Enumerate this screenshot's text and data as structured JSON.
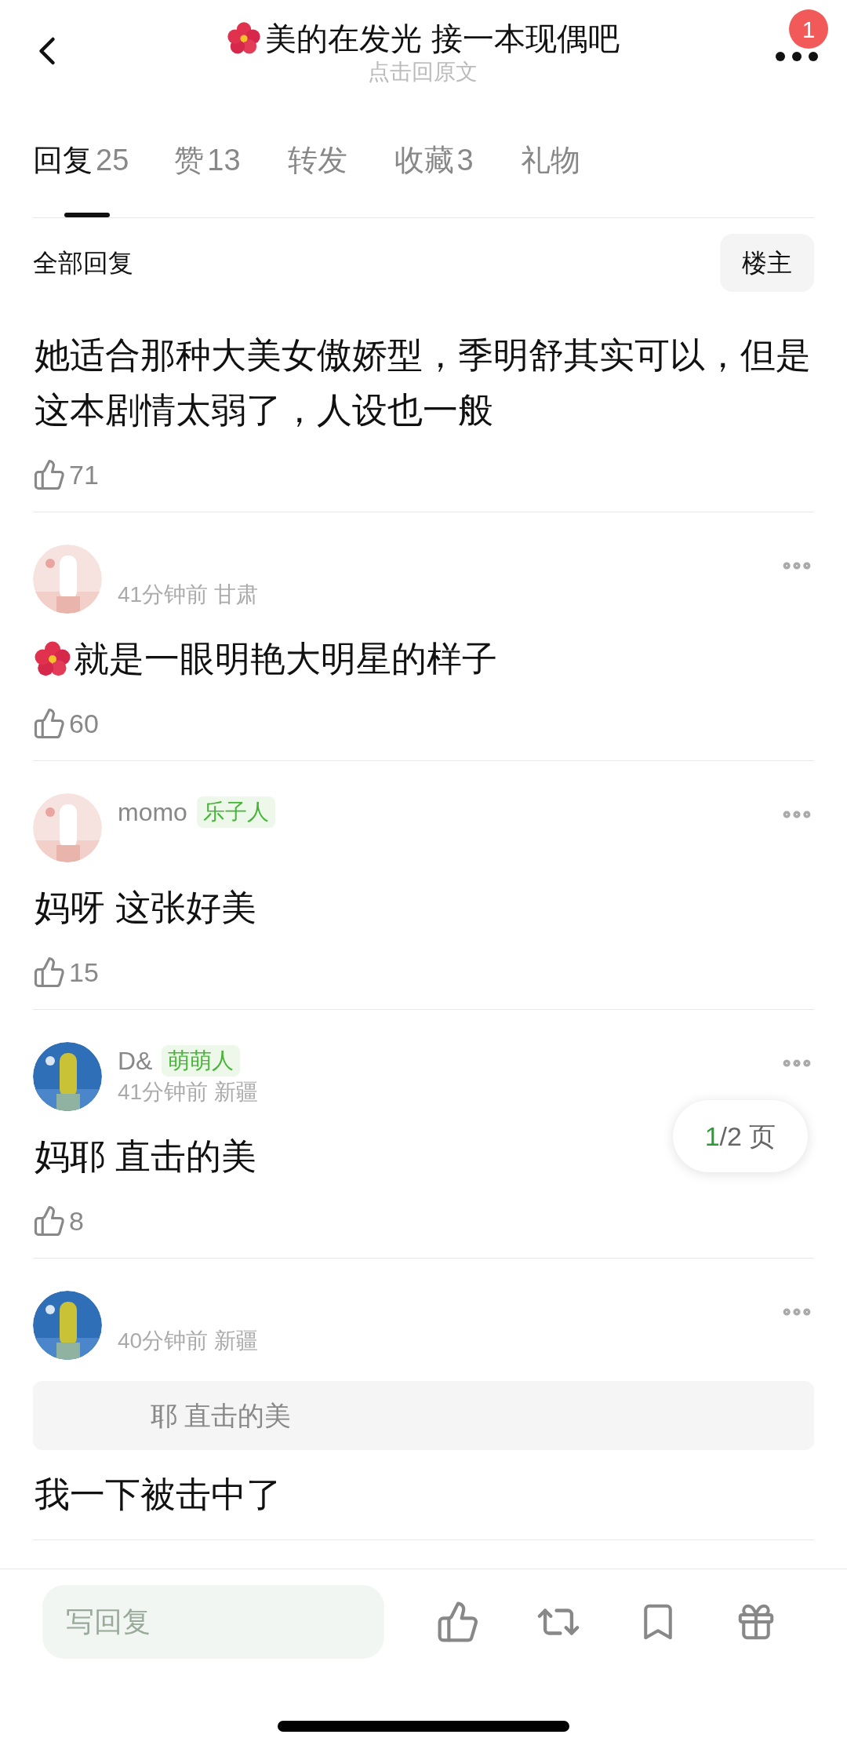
{
  "header": {
    "title": "美的在发光 接一本现偶吧",
    "subtitle": "点击回原文",
    "notification_count": "1"
  },
  "tabs": [
    {
      "label": "回复",
      "count": "25",
      "selected": true
    },
    {
      "label": "赞",
      "count": "13",
      "selected": false
    },
    {
      "label": "转发",
      "selected": false
    },
    {
      "label": "收藏",
      "count": "3",
      "selected": false
    },
    {
      "label": "礼物",
      "selected": false
    }
  ],
  "section_title": "全部回复",
  "filter_button": "楼主",
  "comments": [
    {
      "text": "她适合那种大美女傲娇型，季明舒其实可以，但是这本剧情太弱了，人设也一般",
      "emoji_prefix": false,
      "likes": "71"
    },
    {
      "time": "41分钟前",
      "location": "甘肃",
      "emoji_prefix": true,
      "text": "就是一眼明艳大明星的样子",
      "likes": "60"
    },
    {
      "author": "momo",
      "badge": "乐子人",
      "emoji_prefix": false,
      "text": "妈呀 这张好美",
      "likes": "15"
    },
    {
      "author": "D&",
      "badge": "萌萌人",
      "time": "41分钟前",
      "location": "新疆",
      "emoji_prefix": false,
      "text": "妈耶 直击的美",
      "likes": "8"
    },
    {
      "time": "40分钟前",
      "location": "新疆",
      "quote": "耶 直击的美",
      "emoji_prefix": false,
      "text": "我一下被击中了"
    }
  ],
  "pager": {
    "current": "1",
    "rest": "/2 页"
  },
  "bottom_bar": {
    "reply_placeholder": "写回复"
  }
}
